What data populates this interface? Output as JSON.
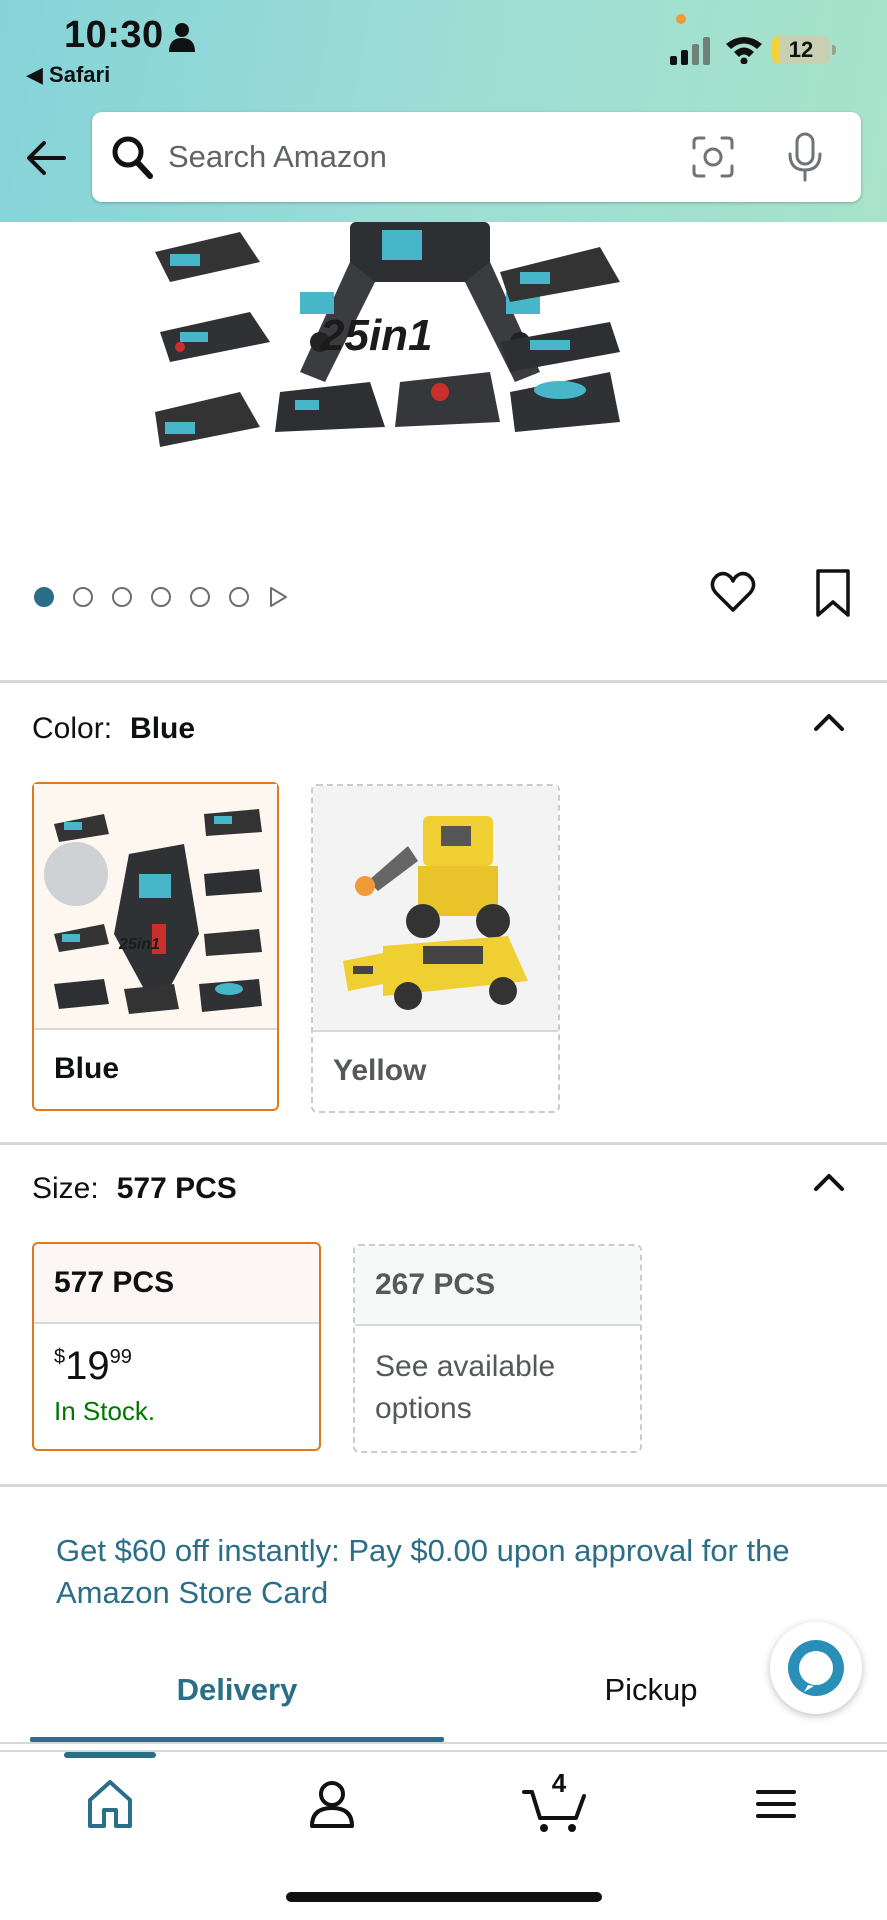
{
  "status_bar": {
    "time": "10:30",
    "back_app": "Safari",
    "battery": "12",
    "battery_level": 0.12
  },
  "header": {
    "search_placeholder": "Search Amazon",
    "icons": [
      "back-arrow-icon",
      "search-icon",
      "camera-icon",
      "microphone-icon"
    ]
  },
  "product_image": {
    "overlay_text": "25in1",
    "carousel": {
      "total": 6,
      "active_index": 0
    }
  },
  "color": {
    "label": "Color:",
    "selected_value": "Blue",
    "options": [
      {
        "label": "Blue",
        "state": "selected"
      },
      {
        "label": "Yellow",
        "state": "unavailable"
      }
    ]
  },
  "size": {
    "label": "Size:",
    "selected_value": "577 PCS",
    "options": [
      {
        "label": "577 PCS",
        "price_symbol": "$",
        "price_whole": "19",
        "price_fraction": "99",
        "stock": "In Stock.",
        "state": "selected"
      },
      {
        "label": "267 PCS",
        "note": "See available options",
        "state": "unavailable"
      }
    ]
  },
  "promo": {
    "text": "Get $60 off instantly: Pay $0.00 upon approval for the Amazon Store Card"
  },
  "tabs": [
    {
      "label": "Delivery",
      "active": true
    },
    {
      "label": "Pickup",
      "active": false
    }
  ],
  "bottom_nav": {
    "items": [
      "home-icon",
      "account-icon",
      "cart-icon",
      "menu-icon"
    ],
    "cart_count": "4"
  },
  "colors": {
    "accent": "#2a6e87",
    "selected_border": "#e0791c",
    "in_stock": "#007600",
    "header_gradient_start": "#85d3d8",
    "header_gradient_end": "#a8e3c9"
  }
}
